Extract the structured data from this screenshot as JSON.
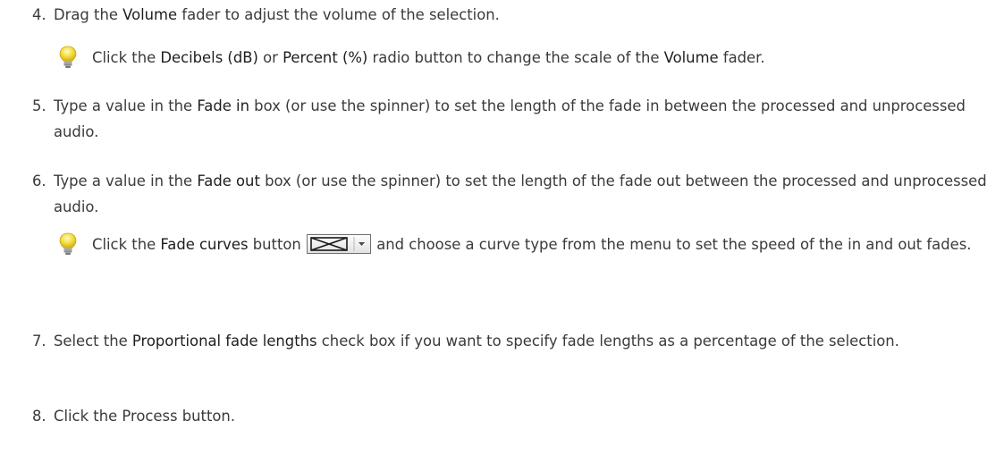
{
  "steps": [
    {
      "number": "4.",
      "parts": [
        "Drag the ",
        "Volume",
        " fader to adjust the volume of the selection."
      ]
    },
    {
      "number": "5.",
      "parts": [
        "Type a value in the ",
        "Fade in",
        " box (or use the spinner) to set the length of the fade in between the processed and unprocessed audio."
      ]
    },
    {
      "number": "6.",
      "parts": [
        "Type a value in the ",
        "Fade out",
        " box (or use the spinner) to set the length of the fade out between the processed and unprocessed audio."
      ]
    },
    {
      "number": "7.",
      "parts": [
        "Select the ",
        "Proportional fade lengths",
        " check box if you want to specify fade lengths as a percentage of the selection."
      ]
    },
    {
      "number": "8.",
      "text": "Click the Process button."
    }
  ],
  "tips": [
    {
      "icon": "lightbulb-icon",
      "parts": [
        "Click the ",
        "Decibels (dB)",
        " or ",
        "Percent (%)",
        " radio button to change the scale of the ",
        "Volume",
        " fader."
      ]
    },
    {
      "icon": "lightbulb-icon",
      "before_button": [
        "Click the ",
        "Fade curves",
        " button "
      ],
      "button_icon": "fade-curves-icon",
      "after_button": " and choose a curve type from the menu to set the speed of the in and out fades."
    }
  ],
  "colors": {
    "text": "#3a3a3a",
    "bulb": "#f3de3c",
    "bulb_base": "#9a9a9a"
  }
}
